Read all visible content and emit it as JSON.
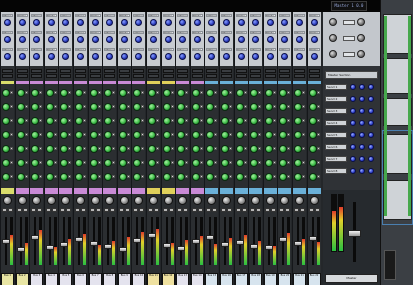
{
  "header": {
    "readout": "Master 1 0.0"
  },
  "fx_labels": [
    "Return 1",
    "Return 2",
    "Return 3",
    "Return 4",
    "Return 5"
  ],
  "strips": [
    {
      "name": "Bus 1",
      "color": "#e8e5a4"
    },
    {
      "name": "Bus 2",
      "color": "#e8e5a4"
    },
    {
      "name": "Bus 3",
      "color": "#e4e3ee"
    },
    {
      "name": "Bus 4",
      "color": "#e4e3ee"
    },
    {
      "name": "Bus 5",
      "color": "#e4e3ee"
    },
    {
      "name": "Bus 6",
      "color": "#e4e3ee"
    },
    {
      "name": "Bus 7",
      "color": "#e4e3ee"
    },
    {
      "name": "Bus 8",
      "color": "#e4e3ee"
    },
    {
      "name": "Bus 9",
      "color": "#e4e3ee"
    },
    {
      "name": "Bus 10",
      "color": "#e4e3ee"
    },
    {
      "name": "Bus 11",
      "color": "#efe1a0"
    },
    {
      "name": "Bus 12",
      "color": "#efe1a0"
    },
    {
      "name": "Bus 13",
      "color": "#e4e3ee"
    },
    {
      "name": "Bus 14",
      "color": "#e4e3ee"
    },
    {
      "name": "Bus 15",
      "color": "#d7e4ee"
    },
    {
      "name": "Bus 16",
      "color": "#d7e4ee"
    },
    {
      "name": "Bus 17",
      "color": "#d7e4ee"
    },
    {
      "name": "Bus 18",
      "color": "#d7e4ee"
    },
    {
      "name": "Bus 19",
      "color": "#d7e4ee"
    },
    {
      "name": "Bus 20",
      "color": "#d7e4ee"
    },
    {
      "name": "Bus 21",
      "color": "#d7e4ee"
    },
    {
      "name": "Bus 22",
      "color": "#d7e4ee"
    }
  ],
  "strip_colors": [
    "#d9dc6b",
    "#c98ad6",
    "#c98ad6",
    "#c98ad6",
    "#c98ad6",
    "#c98ad6",
    "#c98ad6",
    "#c98ad6",
    "#c98ad6",
    "#c98ad6",
    "#e0d05a",
    "#e0d05a",
    "#c98ad6",
    "#c98ad6",
    "#6ab0d8",
    "#6ab0d8",
    "#6ab0d8",
    "#6ab0d8",
    "#6ab0d8",
    "#6ab0d8",
    "#6ab0d8",
    "#6ab0d8"
  ],
  "master": {
    "display": "Master Section",
    "rows": [
      "Send 1",
      "Send 2",
      "Send 3",
      "Send 4",
      "Send 5",
      "Send 6",
      "Send 7",
      "Send 8"
    ],
    "label": "Master"
  },
  "colors": {
    "eq_green": "#3fbf4a",
    "knob_blue": "#2b3cbf"
  }
}
